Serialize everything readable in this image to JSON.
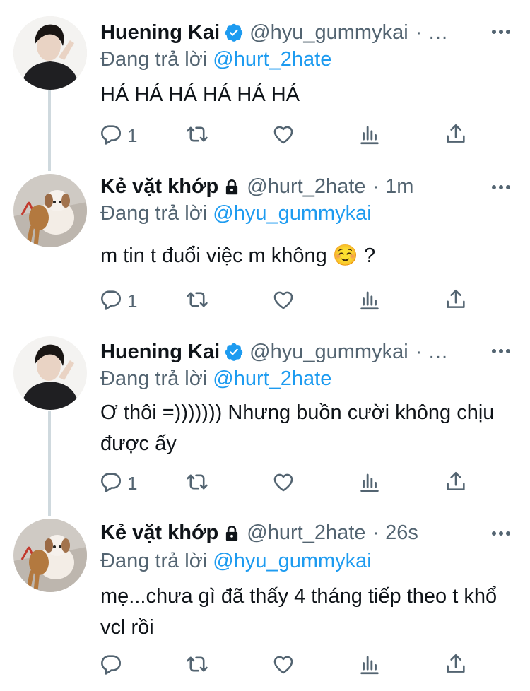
{
  "tweets": [
    {
      "name": "Huening Kai",
      "verified": true,
      "handle": "@hyu_gummykai",
      "time": "· …",
      "reply_prefix": "Đang trả lời ",
      "reply_to": "@hurt_2hate",
      "text": "HÁ HÁ HÁ HÁ HÁ HÁ",
      "reply_count": "1"
    },
    {
      "name": "Kẻ vặt khớp",
      "locked": true,
      "handle": "@hurt_2hate",
      "time": "· 1m",
      "reply_prefix": "Đang trả lời ",
      "reply_to": "@hyu_gummykai",
      "text": "m tin t đuổi việc m không ☺️ ?",
      "reply_count": "1"
    },
    {
      "name": "Huening Kai",
      "verified": true,
      "handle": "@hyu_gummykai",
      "time": "· …",
      "reply_prefix": "Đang trả lời ",
      "reply_to": "@hurt_2hate",
      "text": "Ơ thôi =))))))) Nhưng buồn cười không chịu được ấy",
      "reply_count": "1"
    },
    {
      "name": "Kẻ vặt khớp",
      "locked": true,
      "handle": "@hurt_2hate",
      "time": "· 26s",
      "reply_prefix": "Đang trả lời ",
      "reply_to": "@hyu_gummykai",
      "text": "mẹ...chưa gì đã thấy 4 tháng tiếp theo t khổ vcl rồi",
      "reply_count": ""
    }
  ],
  "colors": {
    "accent": "#1d9bf0",
    "muted": "#536471",
    "thread_line": "#cfd9de"
  },
  "icons": [
    "verified-badge-icon",
    "lock-icon",
    "more-icon",
    "reply-icon",
    "retweet-icon",
    "like-icon",
    "analytics-icon",
    "share-icon"
  ]
}
